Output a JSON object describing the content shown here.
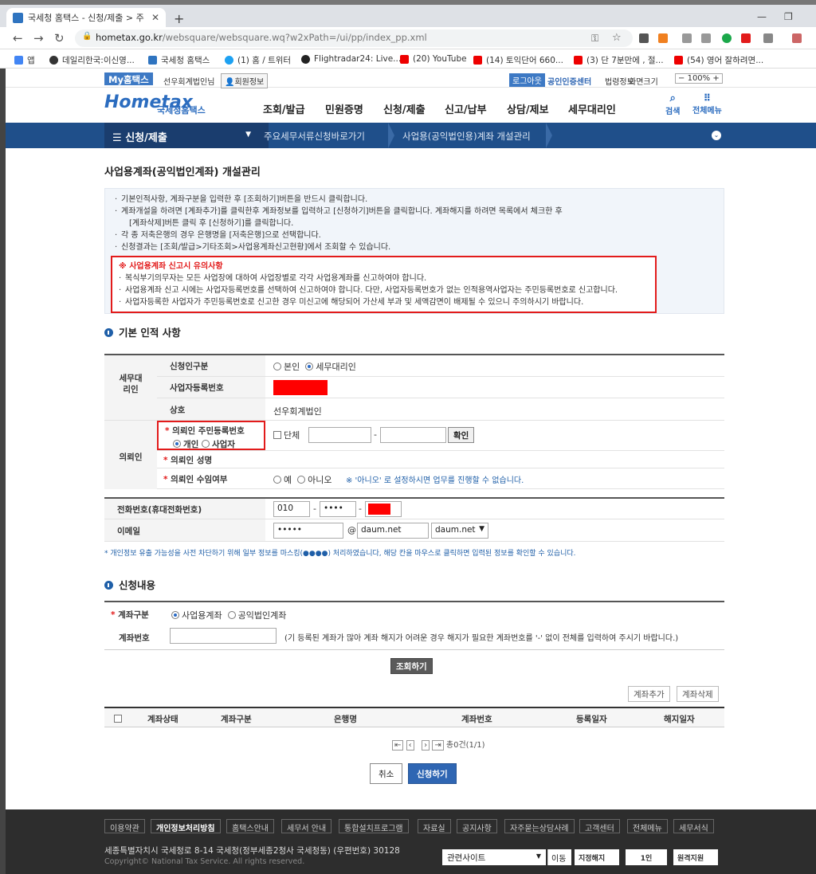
{
  "browser": {
    "tab_title": "국세청 홈택스 - 신청/제출 > 주",
    "url_host": "hometax.go.kr",
    "url_path": "/websquare/websquare.wq?w2xPath=/ui/pp/index_pp.xml",
    "bookmarks": [
      "앱",
      "데일리한국:이신영...",
      "국세청 홈택스",
      "(1) 홈 / 트위터",
      "Flightradar24: Live...",
      "(20) YouTube",
      "(14) 토익단어 660...",
      "(3) 단 7분만에 , 절...",
      "(54) 영어 잘하려면..."
    ]
  },
  "util": {
    "my_label": "My홈택스",
    "username": "선우회계법인님",
    "member_info": "회원정보",
    "logout": "로그아웃",
    "cert_center": "공인인증센터",
    "law_info": "법령정보",
    "zoom_label": "화면크기",
    "zoom_value": "100%"
  },
  "gnb": {
    "logo": "Hometax",
    "logo_sub": "국세청홈택스",
    "menus": [
      "조회/발급",
      "민원증명",
      "신청/제출",
      "신고/납부",
      "상담/제보",
      "세무대리인"
    ],
    "search": "검색",
    "all_menu": "전체메뉴"
  },
  "subnav": {
    "current": "신청/제출",
    "crumb1": "주요세무서류신청바로가기",
    "crumb2": "사업용(공익법인용)계좌 개설관리"
  },
  "page": {
    "title": "사업용계좌(공익법인계좌) 개설관리",
    "guide": [
      "기본인적사항, 계좌구분을 입력한 후 [조회하기]버튼을 반드시 클릭합니다.",
      "계좌개설을 하려면 [계좌추가]를 클릭한후 계좌정보를 입력하고 [신청하기]버튼을 클릭합니다. 계좌해지를 하려면 목록에서 체크한 후",
      "[계좌삭제]버튼 클릭 후 [신청하기]를 클릭합니다.",
      "각 종 저축은행의 경우 은행명을 [저축은행]으로 선택합니다.",
      "신청결과는 [조회/발급>기타조회>사업용계좌신고현황]에서 조회할 수 있습니다."
    ],
    "warn_title": "※ 사업용계좌 신고시 유의사항",
    "warn1": "복식부기의무자는 모든 사업장에 대하여 사업장별로 각각 사업용계좌를 신고하여야 합니다.",
    "warn2": "사업용계좌 신고 시에는 사업자등록번호를 선택하여 신고하여야 합니다. 다만, 사업자등록번호가 없는 인적용역사업자는 주민등록번호로 신고합니다.",
    "warn3": "사업자등록한 사업자가 주민등록번호로 신고한 경우 미신고에 해당되어 가산세 부과 및 세액감면이 배제될 수 있으니 주의하시기 바랍니다."
  },
  "basic": {
    "section_title": "기본 인적 사항",
    "group_agent": "세무대리인",
    "applicant_type_label": "신청인구분",
    "opt_self": "본인",
    "opt_agent": "세무대리인",
    "bizno_label": "사업자등록번호",
    "company_label": "상호",
    "company_value": "선우회계법인",
    "group_client": "의뢰인",
    "client_rrn_label": "의뢰인 주민등록번호",
    "opt_person": "개인",
    "opt_business": "사업자",
    "group_chk": "단체",
    "rrn_sep": "-",
    "confirm": "확인",
    "client_name_label": "의뢰인 성명",
    "client_consent_label": "의뢰인 수임여부",
    "opt_yes": "예",
    "opt_no": "아니오",
    "consent_note": "※ '아니오' 로 설정하시면 업무를 진행할 수 없습니다.",
    "phone_label": "전화번호(휴대전화번호)",
    "phone1": "010",
    "phone2": "••••",
    "phone_sep": "-",
    "email_label": "이메일",
    "email_id": "•••••",
    "email_at": "@",
    "email_domain": "daum.net",
    "email_select": "daum.net",
    "privacy_note": "* 개인정보 유출 가능성을 사전 차단하기 위해 일부 정보를 마스킹(●●●●) 처리하였습니다, 해당 칸을 마우스로 클릭하면 입력된 정보를 확인할 수 있습니다."
  },
  "apply": {
    "section_title": "신청내용",
    "type_label": "계좌구분",
    "opt_biz": "사업용계좌",
    "opt_public": "공익법인계좌",
    "acct_label": "계좌번호",
    "acct_note": "(기 등록된 계좌가 많아 계좌 해지가 어려운 경우 해지가 필요한 계좌번호를 '-' 없이 전체를 입력하여 주시기 바랍니다.)",
    "search_btn": "조회하기",
    "add_btn": "계좌추가",
    "del_btn": "계좌삭제",
    "columns": [
      "계좌상태",
      "계좌구분",
      "은행명",
      "계좌번호",
      "등록일자",
      "해지일자"
    ],
    "pager": "총0건(1/1)",
    "cancel_btn": "취소",
    "submit_btn": "신청하기"
  },
  "footer": {
    "links": [
      "이용약관",
      "개인정보처리방침",
      "홈택스안내",
      "세무서 안내",
      "통합설치프로그램",
      "자료실",
      "공지사항",
      "자주묻는상담사례",
      "고객센터",
      "전체메뉴",
      "세무서식"
    ],
    "address": "세종특별자치시 국세청로 8-14 국세청(정부세종2청사 국세청동) (우편번호) 30128",
    "copyright": "Copyright© National Tax Service. All rights reserved.",
    "related": "관련사이트",
    "move": "이동",
    "banner1": "지정해지",
    "banner2": "1인",
    "banner3": "원격지원"
  },
  "colors": {
    "brand": "#2b6cbf",
    "nav": "#1f4f8a",
    "warn": "#e21b1b",
    "mask": "#ff0000"
  }
}
